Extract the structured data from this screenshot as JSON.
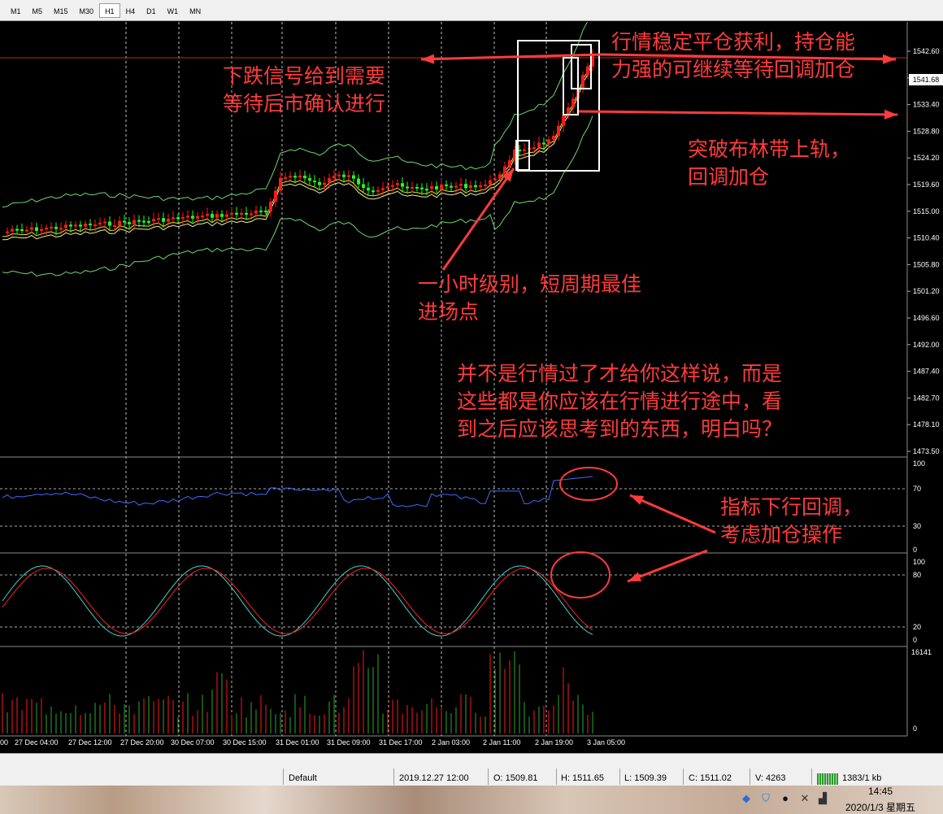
{
  "toolbar": {
    "timeframes": [
      {
        "label": "M1",
        "active": false
      },
      {
        "label": "M5",
        "active": false
      },
      {
        "label": "M15",
        "active": false
      },
      {
        "label": "M30",
        "active": false
      },
      {
        "label": "H1",
        "active": true
      },
      {
        "label": "H4",
        "active": false
      },
      {
        "label": "D1",
        "active": false
      },
      {
        "label": "W1",
        "active": false
      },
      {
        "label": "MN",
        "active": false
      }
    ]
  },
  "chart": {
    "current_price": "1541.68",
    "price_levels": [
      "1542.60",
      "1538.00",
      "1533.40",
      "1528.80",
      "1524.20",
      "1519.60",
      "1515.00",
      "1510.40",
      "1505.80",
      "1501.20",
      "1496.60",
      "1492.00",
      "1487.40",
      "1482.70",
      "1478.10",
      "1473.50"
    ],
    "rsi_levels": [
      "100",
      "70",
      "30",
      "0"
    ],
    "stoch_levels": [
      "100",
      "80",
      "20",
      "0"
    ],
    "volume_levels": [
      "16141",
      "0"
    ],
    "time_labels": [
      "00",
      "27 Dec 04:00",
      "27 Dec 12:00",
      "27 Dec 20:00",
      "30 Dec 07:00",
      "30 Dec 15:00",
      "31 Dec 01:00",
      "31 Dec 09:00",
      "31 Dec 17:00",
      "2 Jan 03:00",
      "2 Jan 11:00",
      "2 Jan 19:00",
      "3 Jan 05:00"
    ]
  },
  "annotations": {
    "top_right": "行情稳定平仓获利，持仓能\n力强的可继续等待回调加仓",
    "top_left": "下跌信号给到需要\n等待后市确认进行",
    "bollinger": "突破布林带上轨，\n回调加仓",
    "entry": "一小时级别，短周期最佳\n进场点",
    "explain": "并不是行情过了才给你这样说，而是\n这些都是你应该在行情进行途中，看\n到之后应该思考到的东西，明白吗？",
    "indicator": "指标下行回调，\n考虑加仓操作"
  },
  "statusbar": {
    "profile": "Default",
    "datetime": "2019.12.27 12:00",
    "open": "O: 1509.81",
    "high": "H: 1511.65",
    "low": "L: 1509.39",
    "close": "C: 1511.02",
    "volume": "V: 4263",
    "traffic": "1383/1 kb"
  },
  "taskbar": {
    "time": "14:45",
    "date": "2020/1/3 星期五"
  },
  "colors": {
    "bull": "#ff1a1a",
    "bear": "#22ff22",
    "annotation": "#ff3b3b",
    "rsi": "#3a6cff",
    "stoch_main": "#40d0d0",
    "stoch_signal": "#ff2020"
  }
}
